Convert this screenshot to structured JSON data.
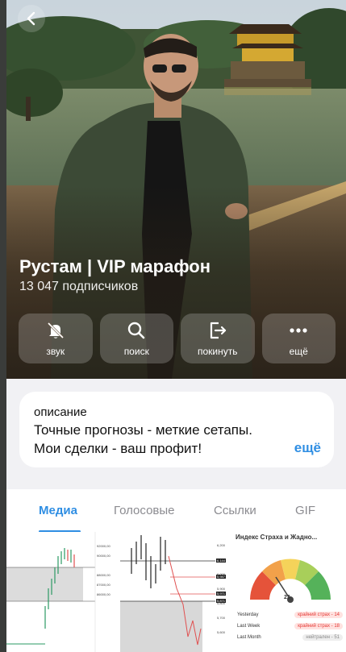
{
  "channel": {
    "title": "Рустам | VIP марафон",
    "subscribers": "13 047 подписчиков"
  },
  "nav": {
    "back_icon": "chevron-left-icon"
  },
  "actions": [
    {
      "icon": "bell-off-icon",
      "label": "звук"
    },
    {
      "icon": "search-icon",
      "label": "поиск"
    },
    {
      "icon": "leave-icon",
      "label": "покинуть"
    },
    {
      "icon": "more-icon",
      "label": "ещё"
    }
  ],
  "description": {
    "label": "описание",
    "line1": "Точные прогнозы - меткие сетапы.",
    "line2": "Мои сделки - ваш профит!",
    "more": "ещё"
  },
  "tabs": [
    {
      "label": "Медиа",
      "active": true
    },
    {
      "label": "Голосовые",
      "active": false
    },
    {
      "label": "Ссылки",
      "active": false
    },
    {
      "label": "GIF",
      "active": false
    }
  ],
  "media": {
    "chart1_axis": [
      "92000,00",
      "90000,00",
      "88000,00",
      "87000,00",
      "86000,00"
    ],
    "chart2_axis": [
      "6,200",
      "6,100",
      "6,000",
      "5,900",
      "5,800",
      "5,700",
      "5,600"
    ],
    "chart2_tags": [
      "6,144",
      "5,987",
      "5,971",
      "5,871"
    ],
    "fear_greed": {
      "title": "Индекс Страха и Жадно...",
      "value": "23",
      "zones": [
        "крайний страх",
        "страх",
        "нейтрально",
        "жадность",
        "крайняя жадность"
      ],
      "rows": [
        {
          "label": "Yesterday",
          "value": "крайний страх - 14"
        },
        {
          "label": "Last Week",
          "value": "крайний страх - 18"
        },
        {
          "label": "Last Month",
          "value": "нейтрален - 51"
        }
      ]
    }
  },
  "colors": {
    "accent": "#2f8ee3",
    "background": "#f1f1f4",
    "card": "#ffffff",
    "muted": "#8b8b90"
  }
}
